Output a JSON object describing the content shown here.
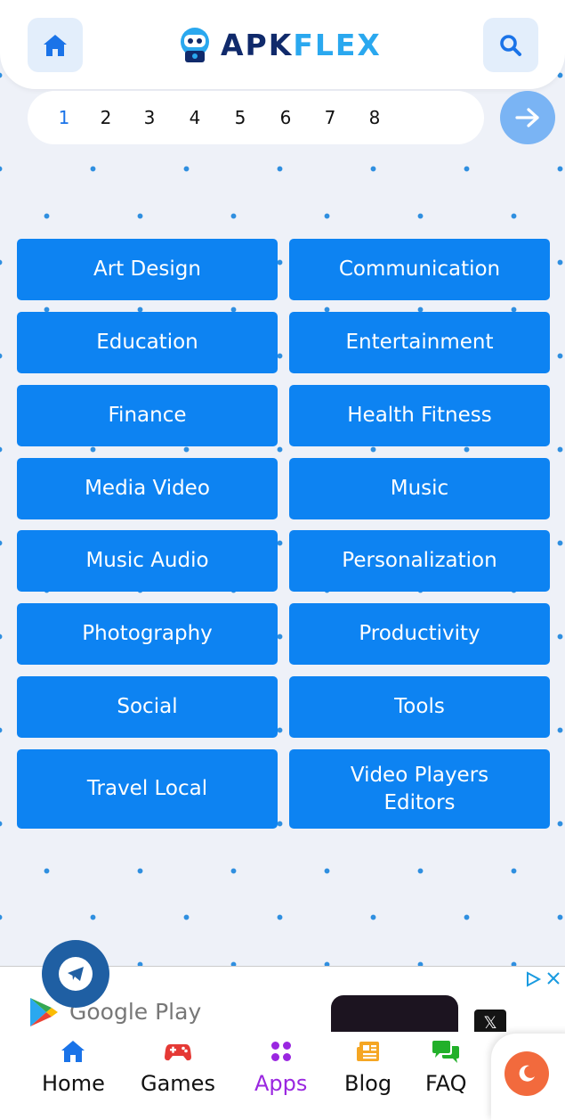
{
  "header": {
    "logo_part1": "APK",
    "logo_part2": "FLEX",
    "home_icon": "home-icon",
    "search_icon": "search-icon"
  },
  "pagination": {
    "pages": [
      "1",
      "2",
      "3",
      "4",
      "5",
      "6",
      "7",
      "8"
    ],
    "active_page": "1",
    "next_icon": "arrow-right-icon"
  },
  "categories": [
    "Art Design",
    "Communication",
    "Education",
    "Entertainment",
    "Finance",
    "Health Fitness",
    "Media Video",
    "Music",
    "Music Audio",
    "Personalization",
    "Photography",
    "Productivity",
    "Social",
    "Tools",
    "Travel Local",
    "Video Players Editors"
  ],
  "ad": {
    "store_label": "Google Play"
  },
  "bottom_nav": {
    "items": [
      {
        "label": "Home",
        "icon": "home-icon",
        "color": "#1a73e8"
      },
      {
        "label": "Games",
        "icon": "gamepad-icon",
        "color": "#e53935"
      },
      {
        "label": "Apps",
        "icon": "apps-icon",
        "color": "#9a27e0"
      },
      {
        "label": "Blog",
        "icon": "newspaper-icon",
        "color": "#f5a623"
      },
      {
        "label": "FAQ",
        "icon": "chat-icon",
        "color": "#22b02a"
      }
    ],
    "active": "Apps"
  },
  "colors": {
    "accent": "#0d83f2",
    "background": "#eef1f8",
    "active_nav": "#9a27e0"
  }
}
